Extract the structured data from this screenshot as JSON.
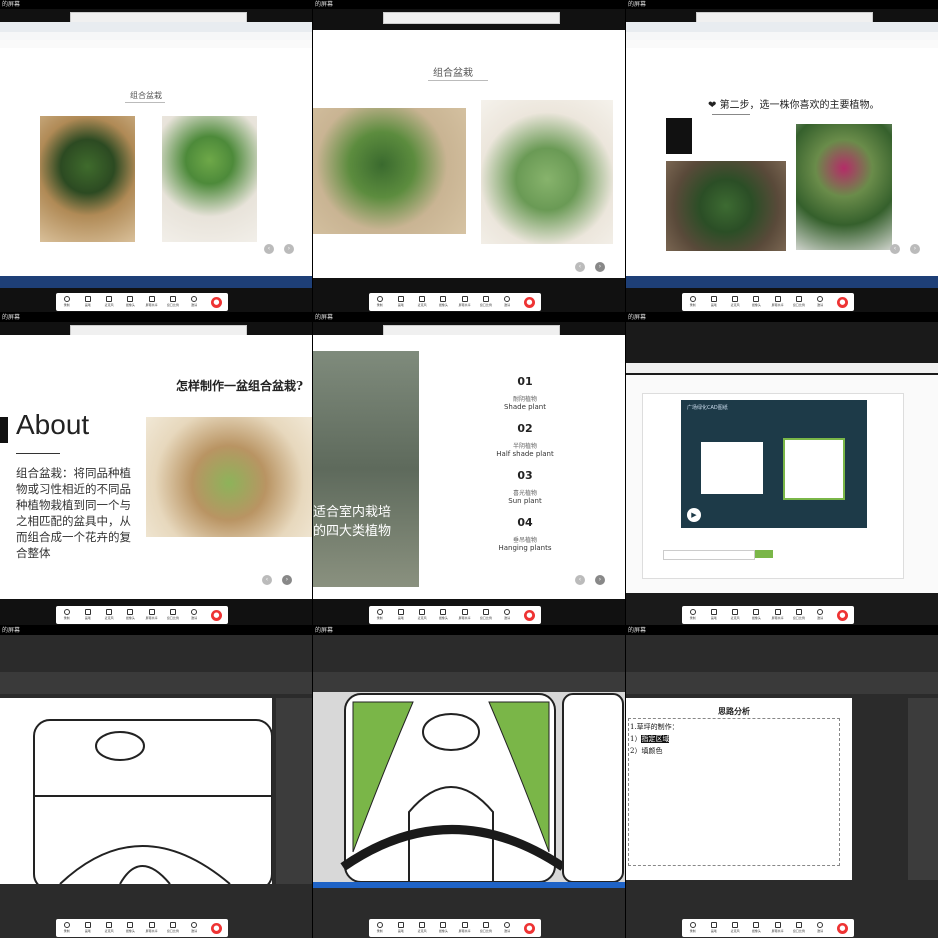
{
  "tiles": [
    {
      "owner": "的屏幕",
      "slide_title": "组合盆栽"
    },
    {
      "owner": "的屏幕",
      "slide_title": "组合盆栽"
    },
    {
      "owner": "的屏幕",
      "slide_title": "第二步，选一株你喜欢的主要植物。"
    },
    {
      "owner": "的屏幕",
      "heading": "怎样制作一盆组合盆栽?",
      "about": "About",
      "about_text": "组合盆栽：将同品种植物或习性相近的不同品种植物栽植到同一个与之相匹配的盆具中，从而组合成一个花卉的复合整体"
    },
    {
      "owner": "的屏幕",
      "overlay_title_1": "适合室内栽培",
      "overlay_title_2": "的四大类植物",
      "items": [
        {
          "num": "01",
          "cn": "耐阴植物",
          "en": "Shade plant"
        },
        {
          "num": "02",
          "cn": "半阴植物",
          "en": "Half shade plant"
        },
        {
          "num": "03",
          "cn": "喜光植物",
          "en": "Sun plant"
        },
        {
          "num": "04",
          "cn": "垂吊植物",
          "en": "Hanging plants"
        }
      ]
    },
    {
      "owner": "的屏幕",
      "video_heading": "广场绿化CAD图纸"
    },
    {
      "owner": "的屏幕"
    },
    {
      "owner": "的屏幕"
    },
    {
      "owner": "的屏幕",
      "doc_title": "思路分析",
      "doc_line1": "1.草坪的制作：",
      "doc_line2_prefix": "1）",
      "doc_line2_highlight": "指定区域",
      "doc_line3": "2）填颜色"
    }
  ],
  "controls": [
    "录制",
    "画笔",
    "麦克风",
    "摄像头",
    "屏幕共享",
    "窗口比例",
    "邀请"
  ],
  "colors": {
    "accent_green": "#7ab648",
    "taskbar": "#1e3f77",
    "end_call": "#e33333"
  }
}
